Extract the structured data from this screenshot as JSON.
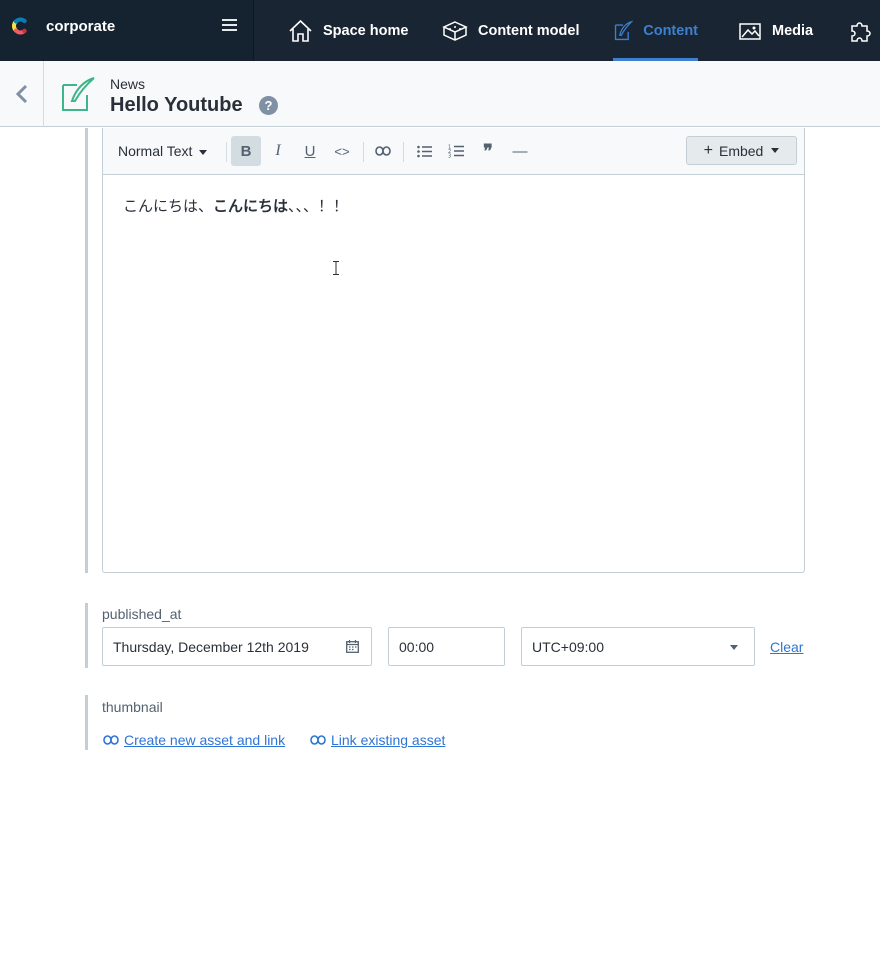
{
  "topnav": {
    "space_name": "corporate",
    "items": [
      {
        "label": "Space home",
        "icon": "home-icon"
      },
      {
        "label": "Content model",
        "icon": "content-model-icon"
      },
      {
        "label": "Content",
        "icon": "content-icon",
        "active": true
      },
      {
        "label": "Media",
        "icon": "media-icon"
      }
    ],
    "accent": "#3c80cf"
  },
  "entry": {
    "content_type": "News",
    "title": "Hello Youtube",
    "help": "?"
  },
  "toolbar": {
    "format": "Normal Text",
    "embed_label": "Embed",
    "buttons": [
      "bold",
      "italic",
      "underline",
      "code",
      "link",
      "bulleted-list",
      "numbered-list",
      "quote",
      "horizontal-rule"
    ],
    "bold_glyph": "B",
    "italic_glyph": "I",
    "underline_glyph": "U",
    "code_glyph": "<>",
    "quote_glyph": "❞",
    "hr_glyph": "—"
  },
  "editor": {
    "text_plain": "こんにちは、",
    "text_bold": "こんにちは",
    "text_tail": "、、、！！"
  },
  "published_at": {
    "label": "published_at",
    "date": "Thursday, December 12th 2019",
    "time": "00:00",
    "timezone": "UTC+09:00",
    "clear": "Clear"
  },
  "thumbnail": {
    "label": "thumbnail",
    "create_link": "Create new asset and link",
    "existing_link": "Link existing asset"
  }
}
